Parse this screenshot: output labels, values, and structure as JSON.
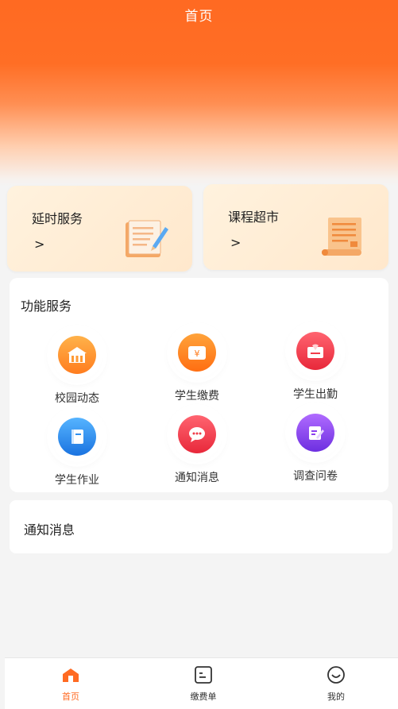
{
  "header": {
    "title": "首页"
  },
  "cards": [
    {
      "title": "延时服务",
      "arrow": ">",
      "icon": "notepad-pen-icon"
    },
    {
      "title": "课程超市",
      "arrow": ">",
      "icon": "scroll-document-icon"
    }
  ],
  "services": {
    "title": "功能服务",
    "items": [
      {
        "label": "校园动态",
        "icon": "school-building-icon",
        "color": "#ff8a2a"
      },
      {
        "label": "学生缴费",
        "icon": "wallet-yen-icon",
        "color": "#ff7a1a"
      },
      {
        "label": "学生出勤",
        "icon": "attendance-card-icon",
        "color": "#f23d4b"
      },
      {
        "label": "学生作业",
        "icon": "homework-book-icon",
        "color": "#2f8ff0"
      },
      {
        "label": "通知消息",
        "icon": "chat-bubble-icon",
        "color": "#ef3b48"
      },
      {
        "label": "调查问卷",
        "icon": "survey-edit-icon",
        "color": "#8c3ff0"
      }
    ]
  },
  "notice": {
    "title": "通知消息"
  },
  "tabbar": {
    "items": [
      {
        "label": "首页",
        "icon": "home-icon",
        "active": true
      },
      {
        "label": "缴费单",
        "icon": "bill-icon",
        "active": false
      },
      {
        "label": "我的",
        "icon": "smiley-profile-icon",
        "active": false
      }
    ],
    "accent": "#ff6a22"
  }
}
